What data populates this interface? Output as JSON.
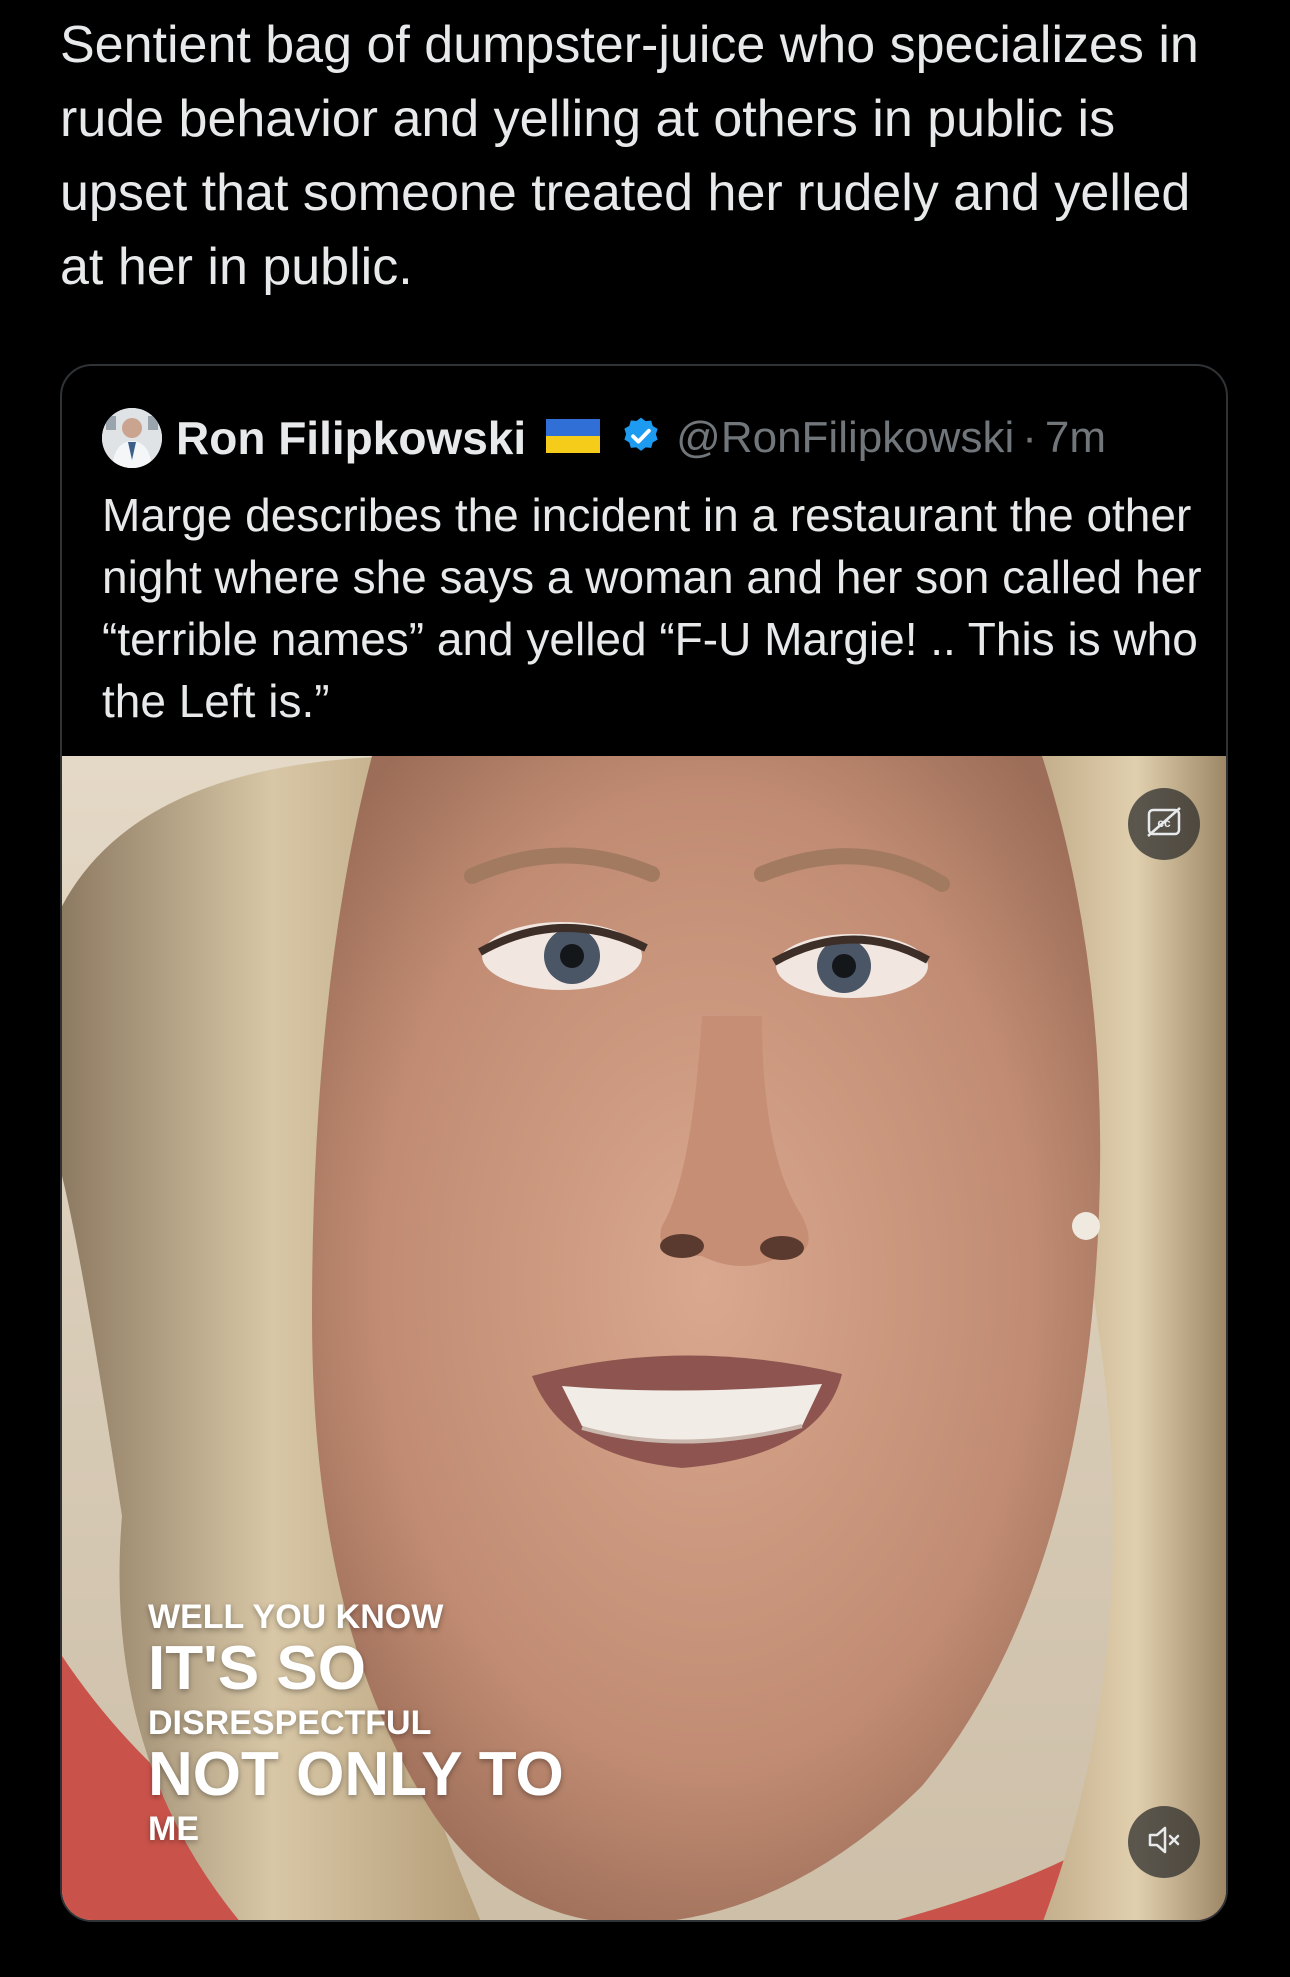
{
  "tweet": {
    "text": "Sentient bag of dumpster-juice who specializes in rude behavior and yelling at others in public is upset that someone treated her rudely and yelled at her in public."
  },
  "quoted_tweet": {
    "author_name": "Ron Filipkowski",
    "handle": "@RonFilipkowski",
    "separator": "·",
    "time": "7m",
    "text": "Marge describes the incident in a restaurant the other night where she says a woman and her son called her “terrible names” and yelled “F-U Margie! .. This is who the Left is.”",
    "flag_icon": "ukraine-flag-icon",
    "verified_icon": "verified-badge-icon",
    "verified_color": "#1d9bf0"
  },
  "video": {
    "captions": [
      "WELL YOU KNOW",
      "IT'S SO",
      "DISRESPECTFUL",
      "NOT ONLY TO",
      "ME"
    ],
    "cc_icon": "captions-icon",
    "mute_icon": "muted-speaker-icon"
  }
}
